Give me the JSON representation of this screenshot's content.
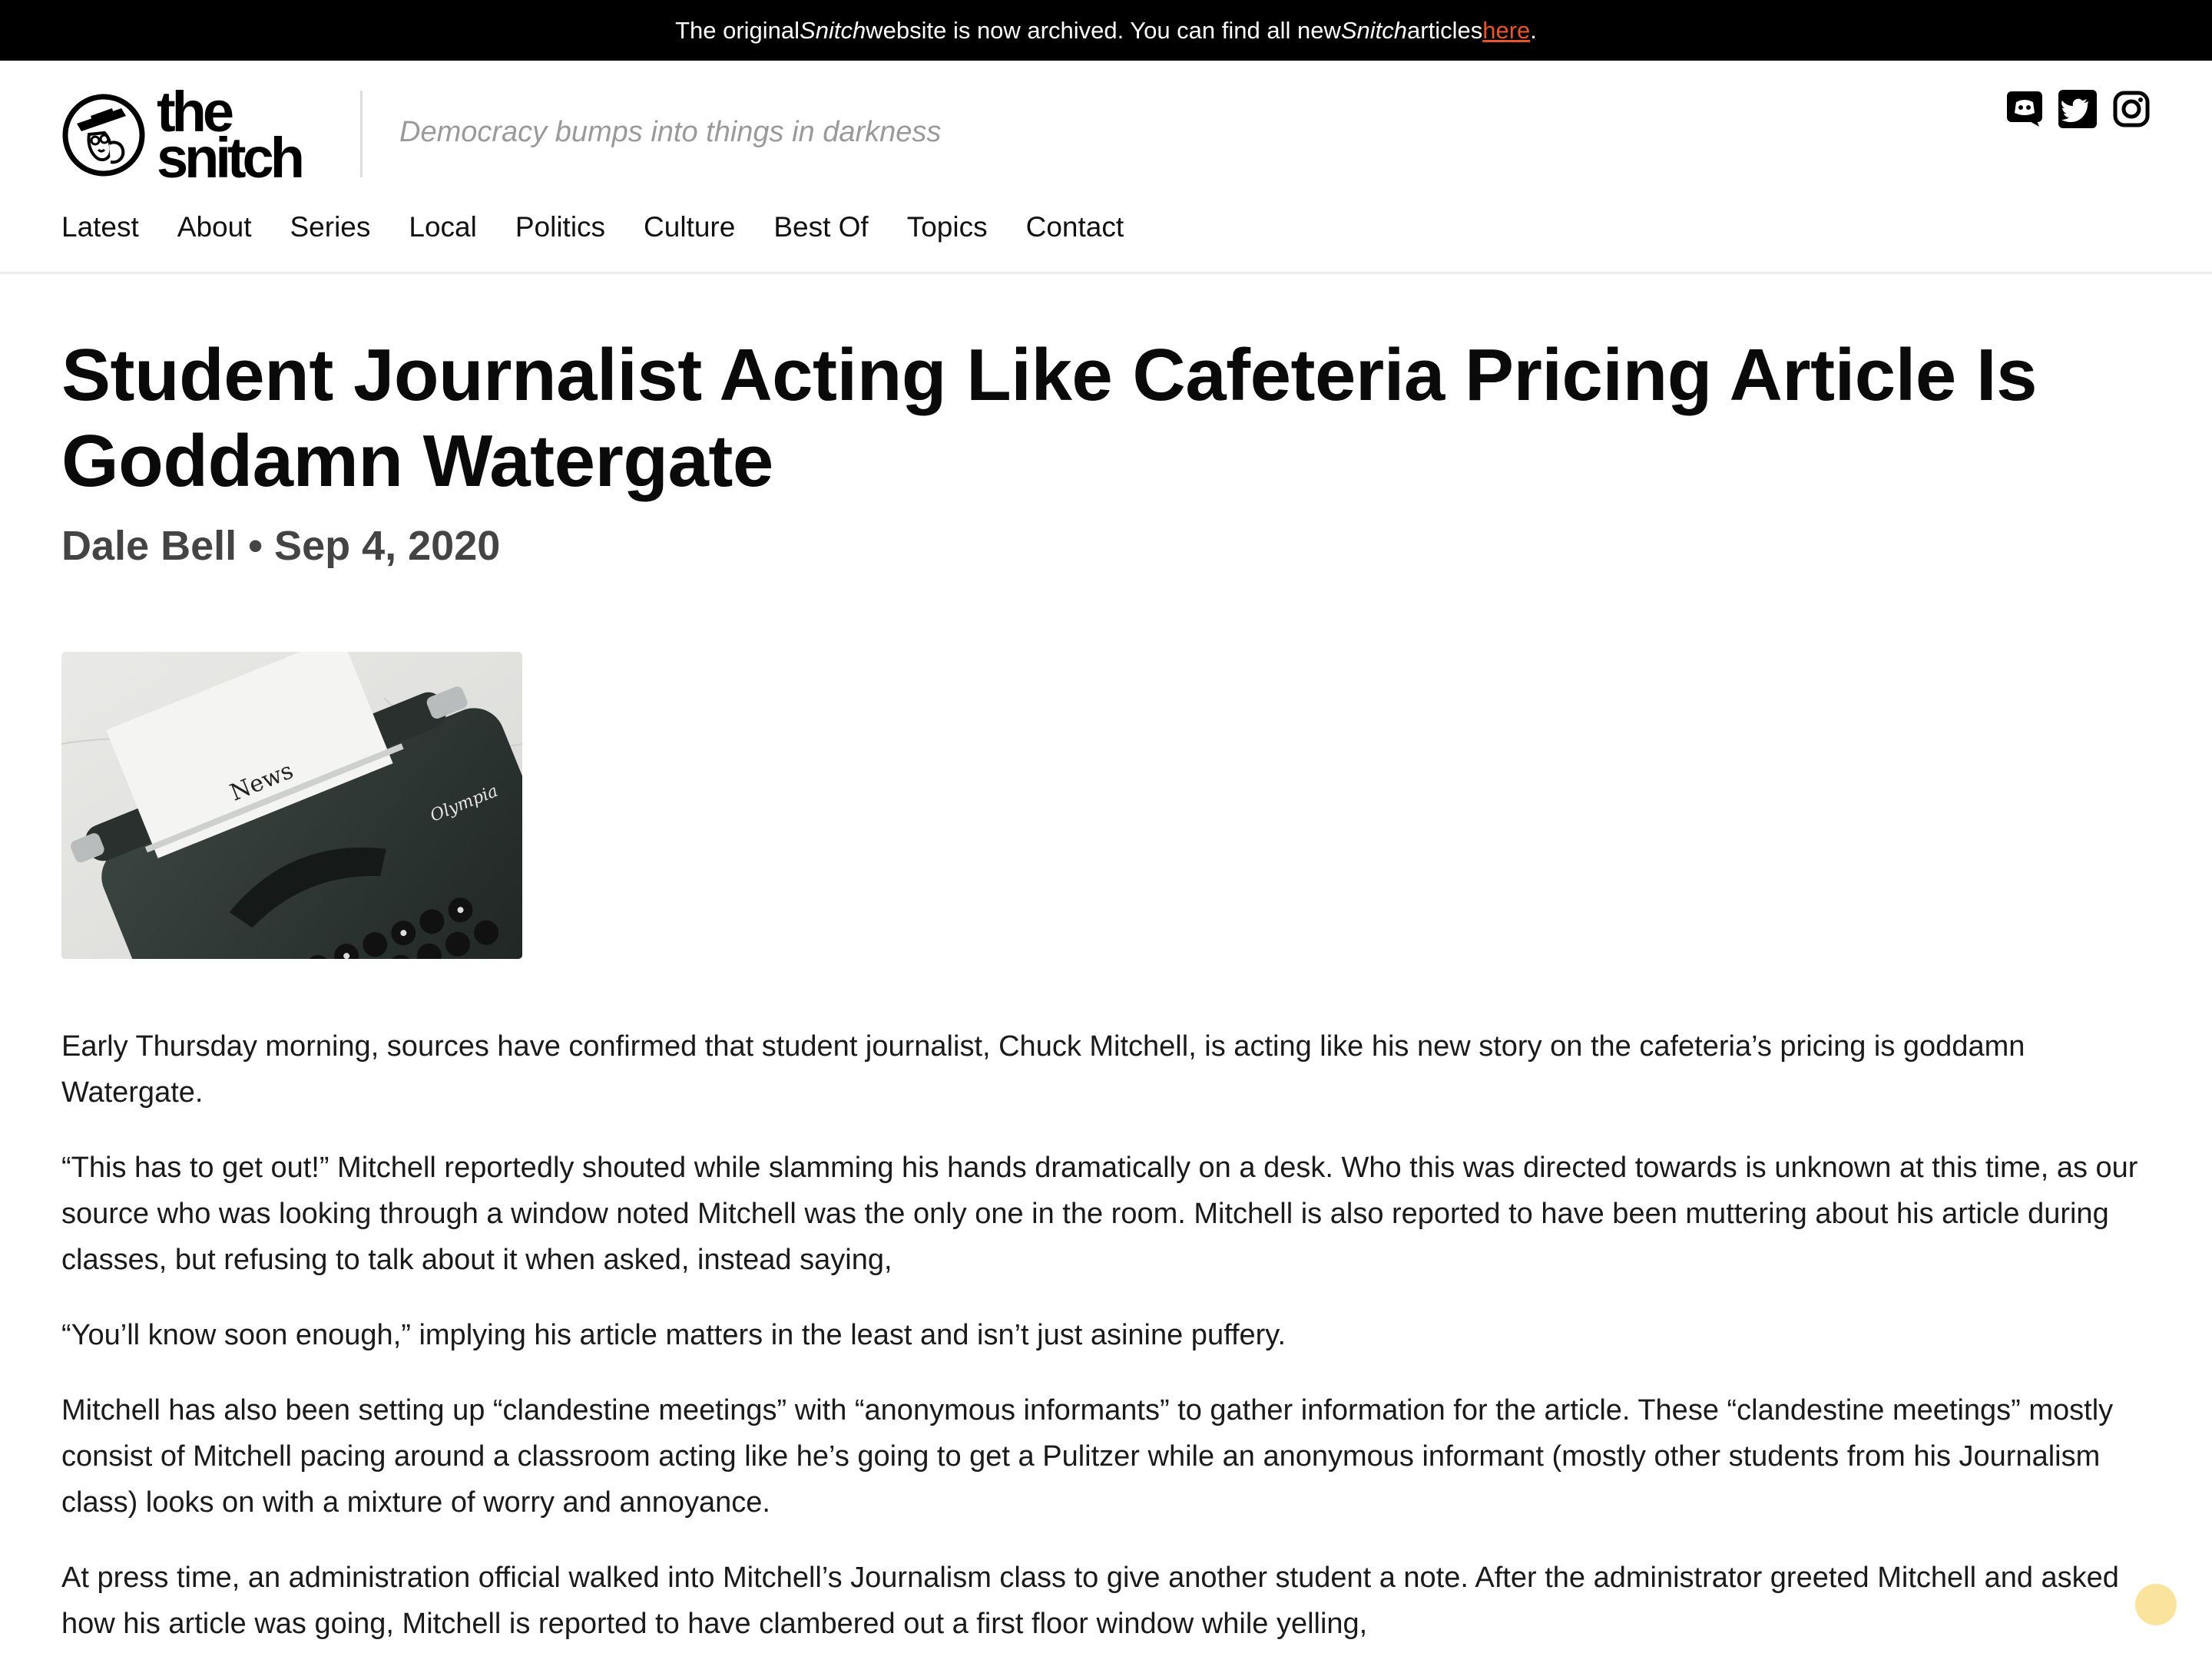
{
  "banner": {
    "part1": "The original ",
    "site1": "Snitch",
    "part2": " website is now archived. You can find all new ",
    "site2": "Snitch",
    "part3": " articles ",
    "link": "here",
    "part4": "."
  },
  "header": {
    "logo_line1": "the",
    "logo_line2": "snitch",
    "tagline": "Democracy bumps into things in darkness",
    "social_icons": [
      "discord-icon",
      "twitter-icon",
      "instagram-icon"
    ]
  },
  "nav": {
    "items": [
      "Latest",
      "About",
      "Series",
      "Local",
      "Politics",
      "Culture",
      "Best Of",
      "Topics",
      "Contact"
    ]
  },
  "article": {
    "title": "Student Journalist Acting Like Cafeteria Pricing Article Is Goddamn Watergate",
    "author": "Dale Bell",
    "separator": "•",
    "date": "Sep 4, 2020",
    "image_paper_text": "News",
    "image_brand_text": "Olympia",
    "paragraphs": [
      "Early Thursday morning, sources have confirmed that student journalist, Chuck Mitchell, is acting like his new story on the cafeteria’s pricing is goddamn Watergate.",
      "“This has to get out!” Mitchell reportedly shouted while slamming his hands dramatically on a desk. Who this was directed towards is unknown at this time, as our source who was looking through a window noted Mitchell was the only one in the room. Mitchell is also reported to have been muttering about his article during classes, but refusing to talk about it when asked, instead saying,",
      "“You’ll know soon enough,” implying his article matters in the least and isn’t just asinine puffery.",
      "Mitchell has also been setting up “clandestine meetings” with “anonymous informants” to gather information for the article. These “clandestine meetings” mostly consist of Mitchell pacing around a classroom acting like he’s going to get a Pulitzer while an anonymous informant (mostly other students from his Journalism class) looks on with a mixture of worry and annoyance.",
      "At press time, an administration official walked into Mitchell’s Journalism class to give another student a note. After the administrator greeted Mitchell and asked how his article was going, Mitchell is reported to have clambered out a first floor window while yelling,"
    ]
  },
  "colors": {
    "banner_bg": "#000000",
    "link": "#e8552d",
    "tagline": "#9a9a9a",
    "byline": "#444444",
    "float_button": "#f8dc84"
  }
}
